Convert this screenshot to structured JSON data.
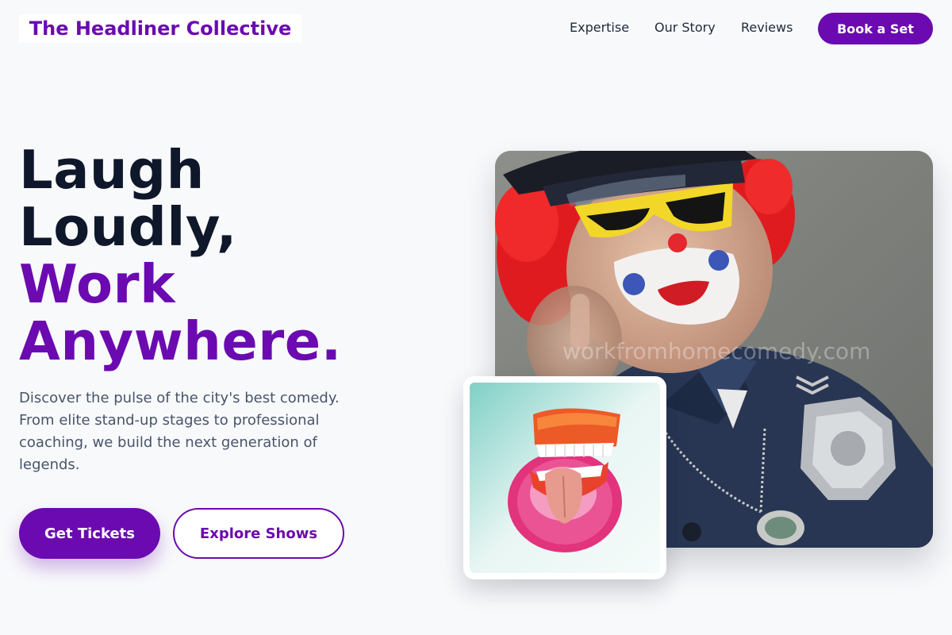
{
  "header": {
    "brand": "The Headliner Collective",
    "nav": [
      "Expertise",
      "Our Story",
      "Reviews"
    ],
    "cta": "Book a Set"
  },
  "hero": {
    "headline_dark": [
      "Laugh",
      "Loudly,"
    ],
    "headline_accent": [
      "Work",
      "Anywhere."
    ],
    "subtext": "Discover the pulse of the city's best comedy. From elite stand-up stages to professional coaching, we build the next generation of legends.",
    "primary_button": "Get Tickets",
    "secondary_button": "Explore Shows"
  },
  "images": {
    "main_watermark": "workfromhomecomedy.com",
    "main_alt": "Clown in police uniform pointing at viewer",
    "card_alt": "Wind-up chattering teeth toy on pink fuzzy base"
  },
  "colors": {
    "accent": "#6b0ab0",
    "text_dark": "#0f172a",
    "text_muted": "#475569",
    "page_bg": "#f8f9fb"
  }
}
